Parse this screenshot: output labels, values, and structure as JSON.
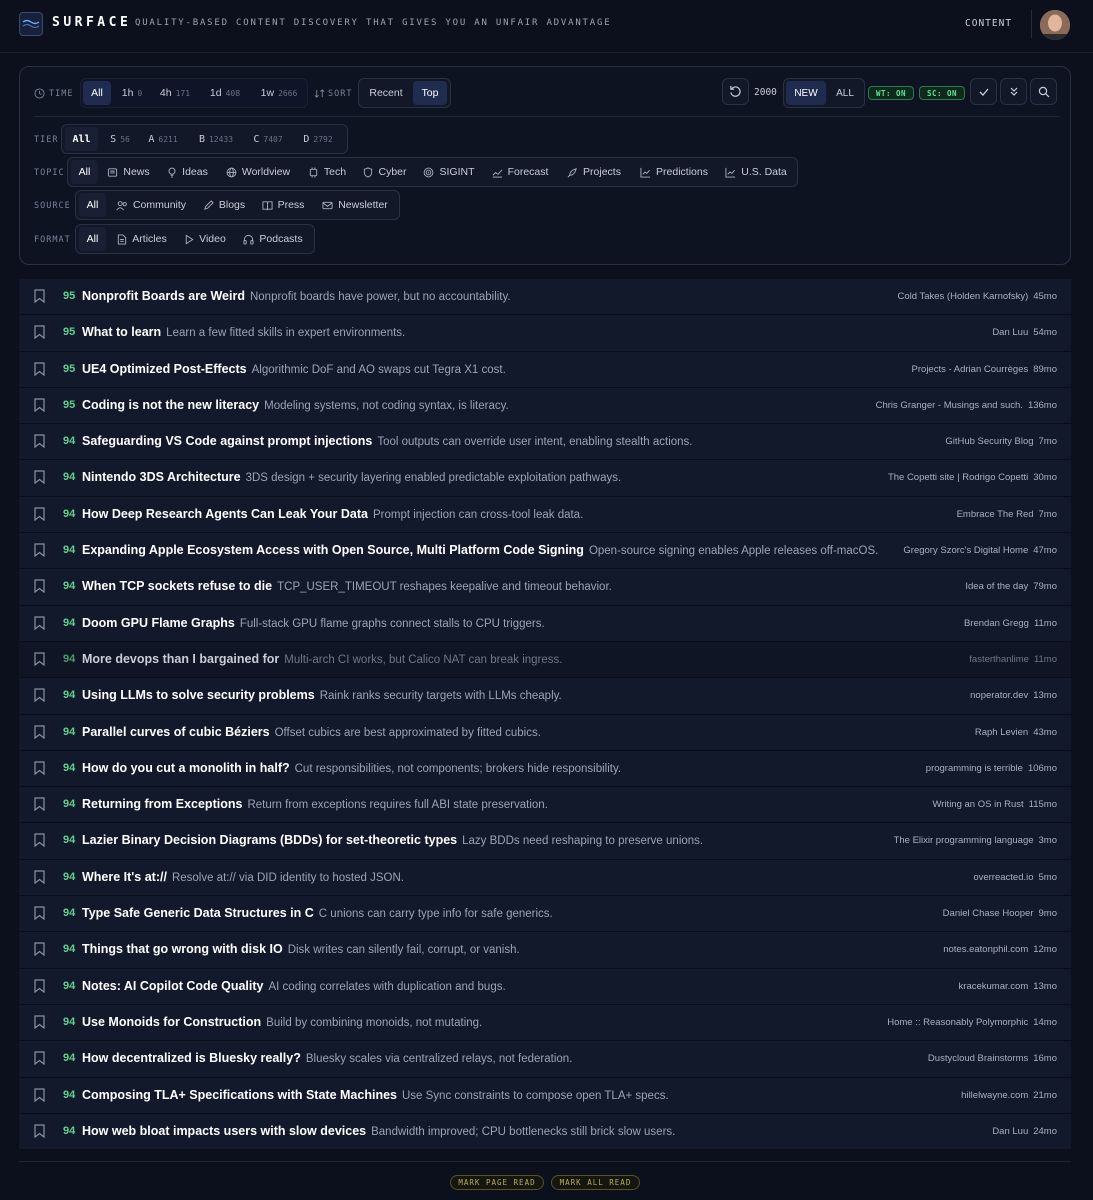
{
  "app": {
    "brand": "SURFACE",
    "tagline": "QUALITY-BASED CONTENT DISCOVERY THAT GIVES YOU AN UNFAIR ADVANTAGE",
    "nav_content": "CONTENT"
  },
  "filters": {
    "time": {
      "label": "TIME",
      "options": [
        {
          "label": "All",
          "count": ""
        },
        {
          "label": "1h",
          "count": "0"
        },
        {
          "label": "4h",
          "count": "171"
        },
        {
          "label": "1d",
          "count": "408"
        },
        {
          "label": "1w",
          "count": "2666"
        }
      ],
      "selected": "All"
    },
    "sort": {
      "label": "SORT",
      "options": [
        "Recent",
        "Top"
      ],
      "selected": "Top"
    },
    "count_value": "2000",
    "view": {
      "options": [
        "NEW",
        "ALL"
      ],
      "selected": "NEW"
    },
    "badges": [
      "WT: ON",
      "SC: ON"
    ],
    "tier": {
      "label": "TIER",
      "options": [
        {
          "label": "All",
          "count": ""
        },
        {
          "label": "S",
          "count": "56"
        },
        {
          "label": "A",
          "count": "6211"
        },
        {
          "label": "B",
          "count": "12433"
        },
        {
          "label": "C",
          "count": "7407"
        },
        {
          "label": "D",
          "count": "2792"
        }
      ],
      "selected": "All"
    },
    "topic": {
      "label": "TOPIC",
      "options": [
        "All",
        "News",
        "Ideas",
        "Worldview",
        "Tech",
        "Cyber",
        "SIGINT",
        "Forecast",
        "Projects",
        "Predictions",
        "U.S. Data"
      ],
      "icons": [
        "",
        "newspaper-icon",
        "lightbulb-icon",
        "globe-icon",
        "cpu-icon",
        "shield-icon",
        "radar-icon",
        "trend-icon",
        "rocket-icon",
        "chart-icon",
        "chart-icon"
      ],
      "selected": "All"
    },
    "source": {
      "label": "SOURCE",
      "options": [
        "All",
        "Community",
        "Blogs",
        "Press",
        "Newsletter"
      ],
      "icons": [
        "",
        "users-icon",
        "pen-icon",
        "book-icon",
        "mail-icon"
      ],
      "selected": "All"
    },
    "format": {
      "label": "FORMAT",
      "options": [
        "All",
        "Articles",
        "Video",
        "Podcasts"
      ],
      "icons": [
        "",
        "document-icon",
        "play-icon",
        "headphones-icon"
      ],
      "selected": "All"
    }
  },
  "feed": [
    {
      "score": "95",
      "title": "Nonprofit Boards are Weird",
      "summary": "Nonprofit boards have power, but no accountability.",
      "source": "Cold Takes (Holden Karnofsky)",
      "age": "45mo",
      "read": false
    },
    {
      "score": "95",
      "title": "What to learn",
      "summary": "Learn a few fitted skills in expert environments.",
      "source": "Dan Luu",
      "age": "54mo",
      "read": false
    },
    {
      "score": "95",
      "title": "UE4 Optimized Post-Effects",
      "summary": "Algorithmic DoF and AO swaps cut Tegra X1 cost.",
      "source": "Projects - Adrian Courrèges",
      "age": "89mo",
      "read": false
    },
    {
      "score": "95",
      "title": "Coding is not the new literacy",
      "summary": "Modeling systems, not coding syntax, is literacy.",
      "source": "Chris Granger - Musings and such.",
      "age": "136mo",
      "read": false
    },
    {
      "score": "94",
      "title": "Safeguarding VS Code against prompt injections",
      "summary": "Tool outputs can override user intent, enabling stealth actions.",
      "source": "GitHub Security Blog",
      "age": "7mo",
      "read": false
    },
    {
      "score": "94",
      "title": "Nintendo 3DS Architecture",
      "summary": "3DS design + security layering enabled predictable exploitation pathways.",
      "source": "The Copetti site | Rodrigo Copetti",
      "age": "30mo",
      "read": false
    },
    {
      "score": "94",
      "title": "How Deep Research Agents Can Leak Your Data",
      "summary": "Prompt injection can cross-tool leak data.",
      "source": "Embrace The Red",
      "age": "7mo",
      "read": false
    },
    {
      "score": "94",
      "title": "Expanding Apple Ecosystem Access with Open Source, Multi Platform Code Signing",
      "summary": "Open-source signing enables Apple releases off-macOS.",
      "source": "Gregory Szorc's Digital Home",
      "age": "47mo",
      "read": false
    },
    {
      "score": "94",
      "title": "When TCP sockets refuse to die",
      "summary": "TCP_USER_TIMEOUT reshapes keepalive and timeout behavior.",
      "source": "Idea of the day",
      "age": "79mo",
      "read": false
    },
    {
      "score": "94",
      "title": "Doom GPU Flame Graphs",
      "summary": "Full-stack GPU flame graphs connect stalls to CPU triggers.",
      "source": "Brendan Gregg",
      "age": "11mo",
      "read": false
    },
    {
      "score": "94",
      "title": "More devops than I bargained for",
      "summary": "Multi-arch CI works, but Calico NAT can break ingress.",
      "source": "fasterthanlime",
      "age": "11mo",
      "read": true
    },
    {
      "score": "94",
      "title": "Using LLMs to solve security problems",
      "summary": "Raink ranks security targets with LLMs cheaply.",
      "source": "noperator.dev",
      "age": "13mo",
      "read": false
    },
    {
      "score": "94",
      "title": "Parallel curves of cubic Béziers",
      "summary": "Offset cubics are best approximated by fitted cubics.",
      "source": "Raph Levien",
      "age": "43mo",
      "read": false
    },
    {
      "score": "94",
      "title": "How do you cut a monolith in half?",
      "summary": "Cut responsibilities, not components; brokers hide responsibility.",
      "source": "programming is terrible",
      "age": "106mo",
      "read": false
    },
    {
      "score": "94",
      "title": "Returning from Exceptions",
      "summary": "Return from exceptions requires full ABI state preservation.",
      "source": "Writing an OS in Rust",
      "age": "115mo",
      "read": false
    },
    {
      "score": "94",
      "title": "Lazier Binary Decision Diagrams (BDDs) for set-theoretic types",
      "summary": "Lazy BDDs need reshaping to preserve unions.",
      "source": "The Elixir programming language",
      "age": "3mo",
      "read": false
    },
    {
      "score": "94",
      "title": "Where It's at://",
      "summary": "Resolve at:// via DID identity to hosted JSON.",
      "source": "overreacted.io",
      "age": "5mo",
      "read": false
    },
    {
      "score": "94",
      "title": "Type Safe Generic Data Structures in C",
      "summary": "C unions can carry type info for safe generics.",
      "source": "Daniel Chase Hooper",
      "age": "9mo",
      "read": false
    },
    {
      "score": "94",
      "title": "Things that go wrong with disk IO",
      "summary": "Disk writes can silently fail, corrupt, or vanish.",
      "source": "notes.eatonphil.com",
      "age": "12mo",
      "read": false
    },
    {
      "score": "94",
      "title": "Notes: AI Copilot Code Quality",
      "summary": "AI coding correlates with duplication and bugs.",
      "source": "kracekumar.com",
      "age": "13mo",
      "read": false
    },
    {
      "score": "94",
      "title": "Use Monoids for Construction",
      "summary": "Build by combining monoids, not mutating.",
      "source": "Home :: Reasonably Polymorphic",
      "age": "14mo",
      "read": false
    },
    {
      "score": "94",
      "title": "How decentralized is Bluesky really?",
      "summary": "Bluesky scales via centralized relays, not federation.",
      "source": "Dustycloud Brainstorms",
      "age": "16mo",
      "read": false
    },
    {
      "score": "94",
      "title": "Composing TLA+ Specifications with State Machines",
      "summary": "Use Sync constraints to compose open TLA+ specs.",
      "source": "hillelwayne.com",
      "age": "21mo",
      "read": false
    },
    {
      "score": "94",
      "title": "How web bloat impacts users with slow devices",
      "summary": "Bandwidth improved; CPU bottlenecks still brick slow users.",
      "source": "Dan Luu",
      "age": "24mo",
      "read": false
    }
  ],
  "footer": {
    "mark_page_read": "MARK PAGE READ",
    "mark_all_read": "MARK ALL READ"
  }
}
